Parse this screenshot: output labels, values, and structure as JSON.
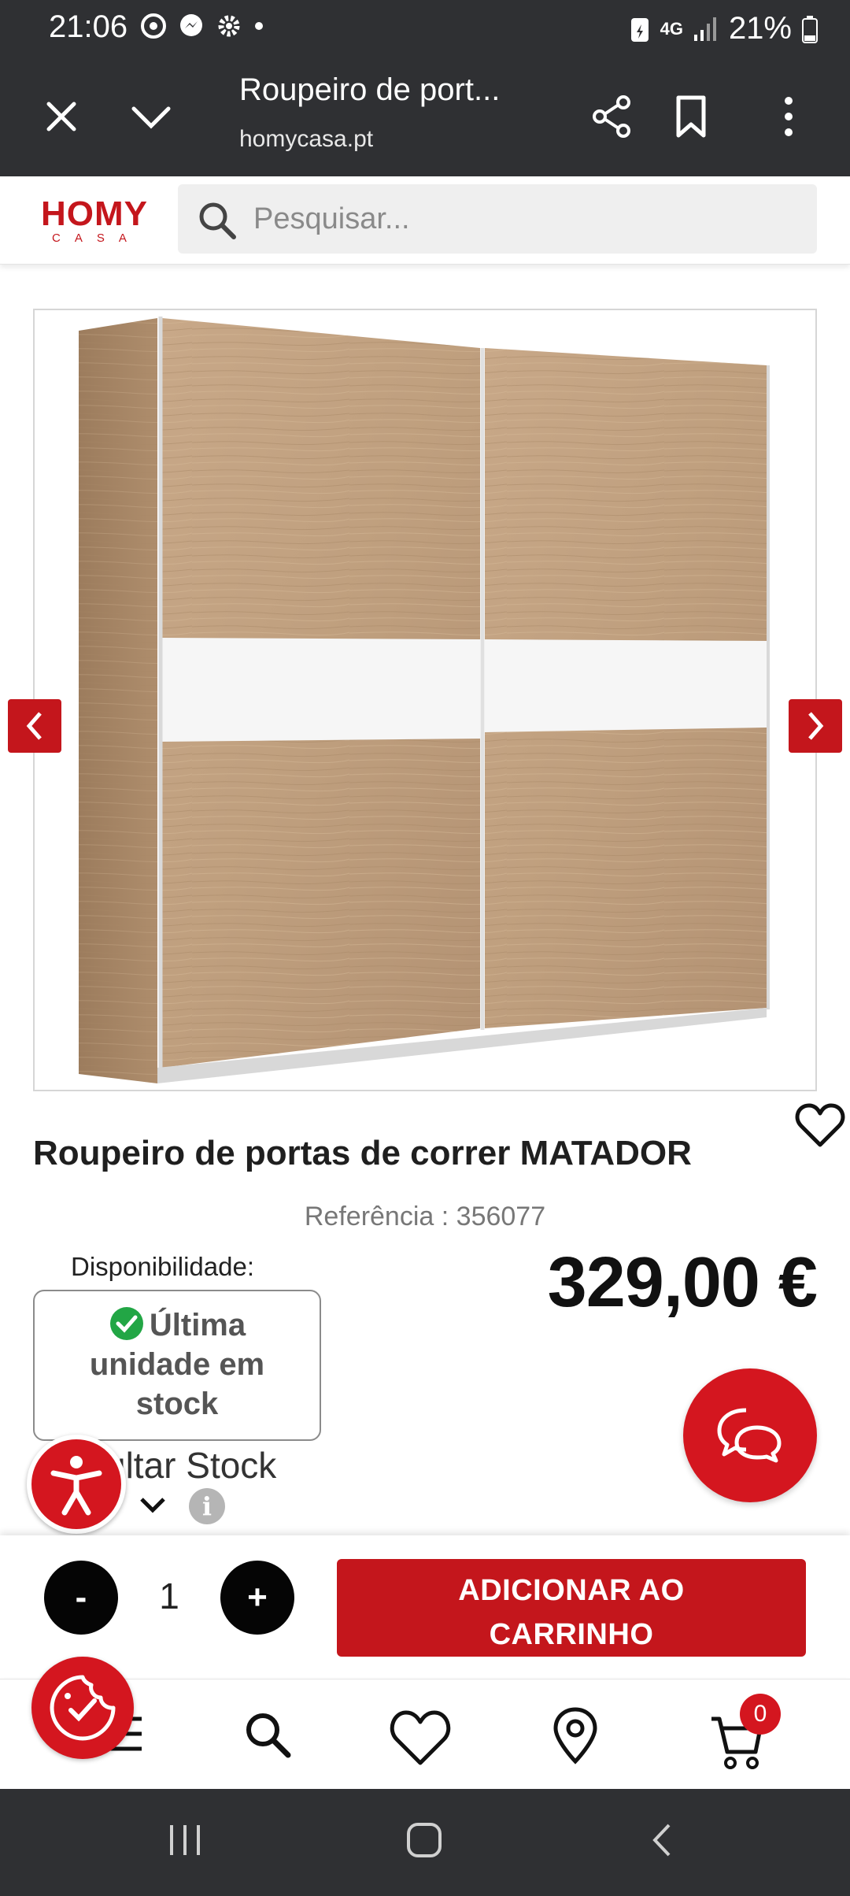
{
  "status_bar": {
    "time": "21:06",
    "network": "4G",
    "battery": "21%"
  },
  "browser": {
    "title": "Roupeiro de port...",
    "url": "homycasa.pt"
  },
  "site": {
    "logo_main": "HOMY",
    "logo_sub": "CASA",
    "brand_color": "#c4161c"
  },
  "search": {
    "placeholder": "Pesquisar..."
  },
  "product": {
    "name": "Roupeiro de portas de correr MATADOR",
    "reference_label": "Referência :",
    "reference": "356077",
    "availability_label": "Disponibilidade:",
    "stock_lines": [
      "Última",
      "unidade em",
      "stock"
    ],
    "consult_stock": "ultar Stock",
    "price": "329,00 €"
  },
  "cart": {
    "minus": "-",
    "quantity": "1",
    "plus": "+",
    "add_line1": "ADICIONAR AO",
    "add_line2": "CARRINHO",
    "badge_count": "0"
  }
}
